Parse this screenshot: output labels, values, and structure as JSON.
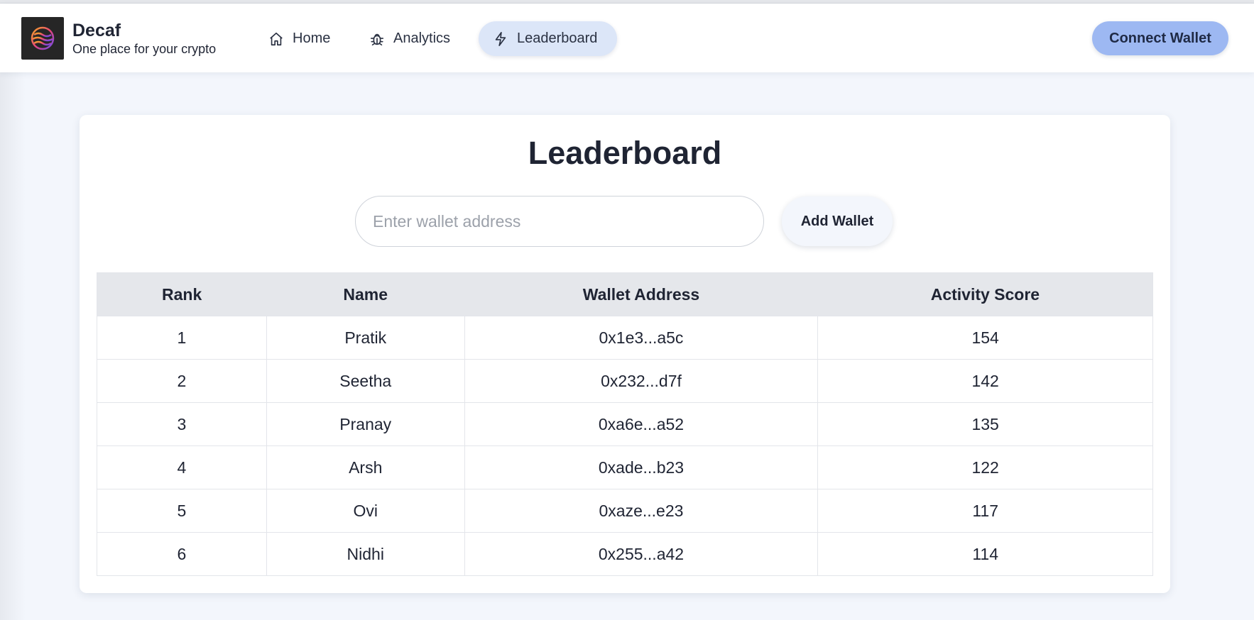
{
  "header": {
    "brand_name": "Decaf",
    "brand_tagline": "One place for your crypto",
    "nav": [
      {
        "label": "Home",
        "icon": "home-icon"
      },
      {
        "label": "Analytics",
        "icon": "bug-icon"
      },
      {
        "label": "Leaderboard",
        "icon": "lightning-icon",
        "active": true
      }
    ],
    "connect_label": "Connect Wallet"
  },
  "main": {
    "title": "Leaderboard",
    "input_placeholder": "Enter wallet address",
    "add_label": "Add Wallet",
    "columns": [
      "Rank",
      "Name",
      "Wallet Address",
      "Activity Score"
    ],
    "rows": [
      {
        "rank": "1",
        "name": "Pratik",
        "address": "0x1e3...a5c",
        "score": "154"
      },
      {
        "rank": "2",
        "name": "Seetha",
        "address": "0x232...d7f",
        "score": "142"
      },
      {
        "rank": "3",
        "name": "Pranay",
        "address": "0xa6e...a52",
        "score": "135"
      },
      {
        "rank": "4",
        "name": "Arsh",
        "address": "0xade...b23",
        "score": "122"
      },
      {
        "rank": "5",
        "name": "Ovi",
        "address": "0xaze...e23",
        "score": "117"
      },
      {
        "rank": "6",
        "name": "Nidhi",
        "address": "0x255...a42",
        "score": "114"
      }
    ]
  },
  "colors": {
    "accent": "#9db8f2",
    "active_nav_bg": "#dce6f8",
    "page_bg": "#f3f6fc",
    "table_header_bg": "#e5e7eb"
  }
}
